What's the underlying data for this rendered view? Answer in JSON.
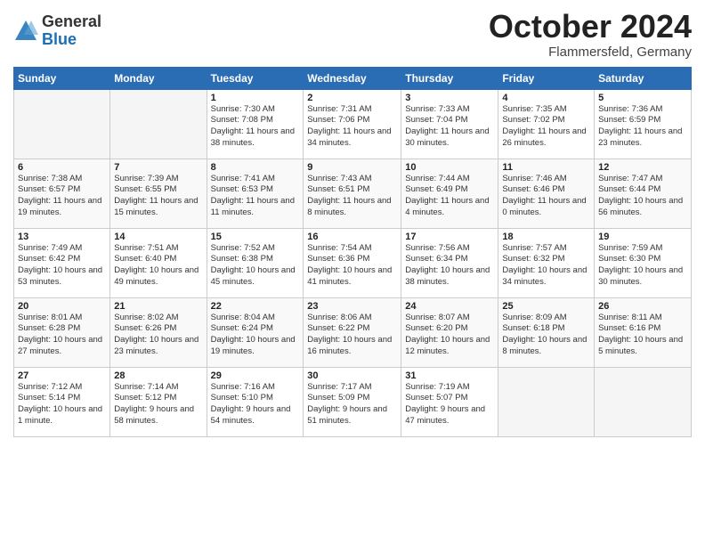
{
  "logo": {
    "general": "General",
    "blue": "Blue"
  },
  "title": "October 2024",
  "location": "Flammersfeld, Germany",
  "weekdays": [
    "Sunday",
    "Monday",
    "Tuesday",
    "Wednesday",
    "Thursday",
    "Friday",
    "Saturday"
  ],
  "weeks": [
    [
      {
        "day": "",
        "empty": true
      },
      {
        "day": "",
        "empty": true
      },
      {
        "day": "1",
        "sunrise": "Sunrise: 7:30 AM",
        "sunset": "Sunset: 7:08 PM",
        "daylight": "Daylight: 11 hours and 38 minutes."
      },
      {
        "day": "2",
        "sunrise": "Sunrise: 7:31 AM",
        "sunset": "Sunset: 7:06 PM",
        "daylight": "Daylight: 11 hours and 34 minutes."
      },
      {
        "day": "3",
        "sunrise": "Sunrise: 7:33 AM",
        "sunset": "Sunset: 7:04 PM",
        "daylight": "Daylight: 11 hours and 30 minutes."
      },
      {
        "day": "4",
        "sunrise": "Sunrise: 7:35 AM",
        "sunset": "Sunset: 7:02 PM",
        "daylight": "Daylight: 11 hours and 26 minutes."
      },
      {
        "day": "5",
        "sunrise": "Sunrise: 7:36 AM",
        "sunset": "Sunset: 6:59 PM",
        "daylight": "Daylight: 11 hours and 23 minutes."
      }
    ],
    [
      {
        "day": "6",
        "sunrise": "Sunrise: 7:38 AM",
        "sunset": "Sunset: 6:57 PM",
        "daylight": "Daylight: 11 hours and 19 minutes."
      },
      {
        "day": "7",
        "sunrise": "Sunrise: 7:39 AM",
        "sunset": "Sunset: 6:55 PM",
        "daylight": "Daylight: 11 hours and 15 minutes."
      },
      {
        "day": "8",
        "sunrise": "Sunrise: 7:41 AM",
        "sunset": "Sunset: 6:53 PM",
        "daylight": "Daylight: 11 hours and 11 minutes."
      },
      {
        "day": "9",
        "sunrise": "Sunrise: 7:43 AM",
        "sunset": "Sunset: 6:51 PM",
        "daylight": "Daylight: 11 hours and 8 minutes."
      },
      {
        "day": "10",
        "sunrise": "Sunrise: 7:44 AM",
        "sunset": "Sunset: 6:49 PM",
        "daylight": "Daylight: 11 hours and 4 minutes."
      },
      {
        "day": "11",
        "sunrise": "Sunrise: 7:46 AM",
        "sunset": "Sunset: 6:46 PM",
        "daylight": "Daylight: 11 hours and 0 minutes."
      },
      {
        "day": "12",
        "sunrise": "Sunrise: 7:47 AM",
        "sunset": "Sunset: 6:44 PM",
        "daylight": "Daylight: 10 hours and 56 minutes."
      }
    ],
    [
      {
        "day": "13",
        "sunrise": "Sunrise: 7:49 AM",
        "sunset": "Sunset: 6:42 PM",
        "daylight": "Daylight: 10 hours and 53 minutes."
      },
      {
        "day": "14",
        "sunrise": "Sunrise: 7:51 AM",
        "sunset": "Sunset: 6:40 PM",
        "daylight": "Daylight: 10 hours and 49 minutes."
      },
      {
        "day": "15",
        "sunrise": "Sunrise: 7:52 AM",
        "sunset": "Sunset: 6:38 PM",
        "daylight": "Daylight: 10 hours and 45 minutes."
      },
      {
        "day": "16",
        "sunrise": "Sunrise: 7:54 AM",
        "sunset": "Sunset: 6:36 PM",
        "daylight": "Daylight: 10 hours and 41 minutes."
      },
      {
        "day": "17",
        "sunrise": "Sunrise: 7:56 AM",
        "sunset": "Sunset: 6:34 PM",
        "daylight": "Daylight: 10 hours and 38 minutes."
      },
      {
        "day": "18",
        "sunrise": "Sunrise: 7:57 AM",
        "sunset": "Sunset: 6:32 PM",
        "daylight": "Daylight: 10 hours and 34 minutes."
      },
      {
        "day": "19",
        "sunrise": "Sunrise: 7:59 AM",
        "sunset": "Sunset: 6:30 PM",
        "daylight": "Daylight: 10 hours and 30 minutes."
      }
    ],
    [
      {
        "day": "20",
        "sunrise": "Sunrise: 8:01 AM",
        "sunset": "Sunset: 6:28 PM",
        "daylight": "Daylight: 10 hours and 27 minutes."
      },
      {
        "day": "21",
        "sunrise": "Sunrise: 8:02 AM",
        "sunset": "Sunset: 6:26 PM",
        "daylight": "Daylight: 10 hours and 23 minutes."
      },
      {
        "day": "22",
        "sunrise": "Sunrise: 8:04 AM",
        "sunset": "Sunset: 6:24 PM",
        "daylight": "Daylight: 10 hours and 19 minutes."
      },
      {
        "day": "23",
        "sunrise": "Sunrise: 8:06 AM",
        "sunset": "Sunset: 6:22 PM",
        "daylight": "Daylight: 10 hours and 16 minutes."
      },
      {
        "day": "24",
        "sunrise": "Sunrise: 8:07 AM",
        "sunset": "Sunset: 6:20 PM",
        "daylight": "Daylight: 10 hours and 12 minutes."
      },
      {
        "day": "25",
        "sunrise": "Sunrise: 8:09 AM",
        "sunset": "Sunset: 6:18 PM",
        "daylight": "Daylight: 10 hours and 8 minutes."
      },
      {
        "day": "26",
        "sunrise": "Sunrise: 8:11 AM",
        "sunset": "Sunset: 6:16 PM",
        "daylight": "Daylight: 10 hours and 5 minutes."
      }
    ],
    [
      {
        "day": "27",
        "sunrise": "Sunrise: 7:12 AM",
        "sunset": "Sunset: 5:14 PM",
        "daylight": "Daylight: 10 hours and 1 minute."
      },
      {
        "day": "28",
        "sunrise": "Sunrise: 7:14 AM",
        "sunset": "Sunset: 5:12 PM",
        "daylight": "Daylight: 9 hours and 58 minutes."
      },
      {
        "day": "29",
        "sunrise": "Sunrise: 7:16 AM",
        "sunset": "Sunset: 5:10 PM",
        "daylight": "Daylight: 9 hours and 54 minutes."
      },
      {
        "day": "30",
        "sunrise": "Sunrise: 7:17 AM",
        "sunset": "Sunset: 5:09 PM",
        "daylight": "Daylight: 9 hours and 51 minutes."
      },
      {
        "day": "31",
        "sunrise": "Sunrise: 7:19 AM",
        "sunset": "Sunset: 5:07 PM",
        "daylight": "Daylight: 9 hours and 47 minutes."
      },
      {
        "day": "",
        "empty": true
      },
      {
        "day": "",
        "empty": true
      }
    ]
  ]
}
